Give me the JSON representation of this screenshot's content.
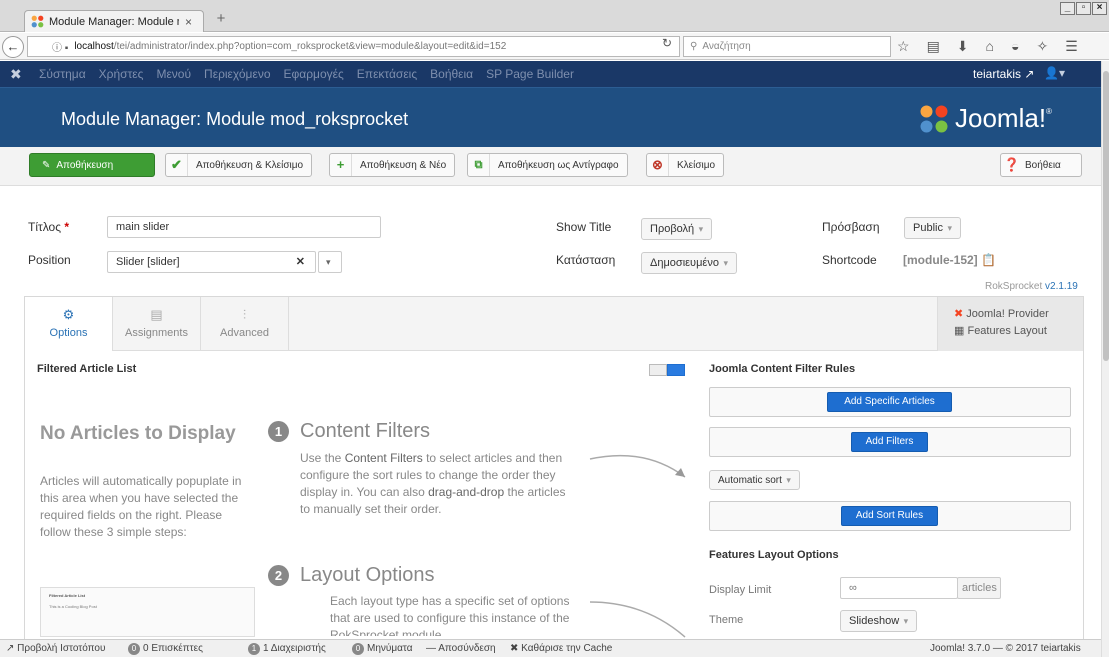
{
  "browser": {
    "tab_title": "Module Manager: Module mod_r",
    "tab_close": "×",
    "new_tab": "+",
    "url_host": "localhost",
    "url_path": "/tei/administrator/index.php?option=com_roksprocket&view=module&layout=edit&id=152",
    "search_placeholder": "Αναζήτηση",
    "window_controls": [
      "_",
      "▫",
      "×"
    ]
  },
  "topmenu": {
    "items": [
      "Σύστημα",
      "Χρήστες",
      "Μενού",
      "Περιεχόμενο",
      "Εφαρμογές",
      "Επεκτάσεις",
      "Βοήθεια",
      "SP Page Builder"
    ],
    "user": "teiartakis"
  },
  "header": {
    "title": "Module Manager: Module mod_roksprocket",
    "logo_text": "Joomla!",
    "logo_mark": "®"
  },
  "toolbar": {
    "save": "Αποθήκευση",
    "save_close": "Αποθήκευση & Κλείσιμο",
    "save_new": "Αποθήκευση & Νέο",
    "save_copy": "Αποθήκευση ως Αντίγραφο",
    "close": "Κλείσιμο",
    "help": "Βοήθεια"
  },
  "form": {
    "title_label": "Τίτλος",
    "title_required": "*",
    "title_value": "main slider",
    "position_label": "Position",
    "position_value": "Slider [slider]",
    "show_title_label": "Show Title",
    "show_title_value": "Προβολή",
    "status_label": "Κατάσταση",
    "status_value": "Δημοσιευμένο",
    "access_label": "Πρόσβαση",
    "access_value": "Public",
    "shortcode_label": "Shortcode",
    "shortcode_value": "[module-152]",
    "version_prefix": "RokSprocket ",
    "version_number": "v2.1.19"
  },
  "tabs": {
    "options": "Options",
    "assignments": "Assignments",
    "advanced": "Advanced",
    "provider": "Joomla! Provider",
    "layout": "Features Layout"
  },
  "left": {
    "section_title": "Filtered Article List",
    "no_articles_title": "No Articles to Display",
    "no_articles_desc": "Articles will automatically popuplate in this area when you have selected the required fields on the right. Please follow these 3 simple steps:",
    "thumb_title": "Filtered Article List",
    "thumb_row": "This is a Cooling Blog Post",
    "step1_num": "1",
    "step1_title": "Content Filters",
    "step1_desc_a": "Use the ",
    "step1_desc_b": "Content Filters",
    "step1_desc_c": " to select articles and then configure the sort rules to change the order they display in. You can also ",
    "step1_desc_d": "drag-and-drop",
    "step1_desc_e": " the articles to manually set their order.",
    "step2_num": "2",
    "step2_title": "Layout Options",
    "step2_desc": "Each layout type has a specific set of options that are used to configure this instance of the RokSprocket module"
  },
  "right": {
    "filter_rules_title": "Joomla Content Filter Rules",
    "add_specific": "Add Specific Articles",
    "add_filters": "Add Filters",
    "auto_sort": "Automatic sort",
    "add_sort_rules": "Add Sort Rules",
    "layout_options_title": "Features Layout Options",
    "display_limit_label": "Display Limit",
    "display_limit_value": "∞",
    "display_limit_unit": "articles",
    "theme_label": "Theme",
    "theme_value": "Slideshow"
  },
  "statusbar": {
    "view_site": "Προβολή Ιστοτόπου",
    "visitors_count": "0",
    "visitors_label": "0 Επισκέπτες",
    "admins_count": "1",
    "admins_label": "1 Διαχειριστής",
    "messages_count": "0",
    "messages_label": "Μηνύματα",
    "logout": "Αποσύνδεση",
    "clear_cache": "Καθάρισε την Cache",
    "version": "Joomla! 3.7.0 — © 2017 teiartakis"
  },
  "colors": {
    "topmenu_bg": "#1a3867",
    "header_bg": "#1f4f82",
    "save_green": "#3e9d34",
    "blue_button": "#1e6ed0"
  }
}
